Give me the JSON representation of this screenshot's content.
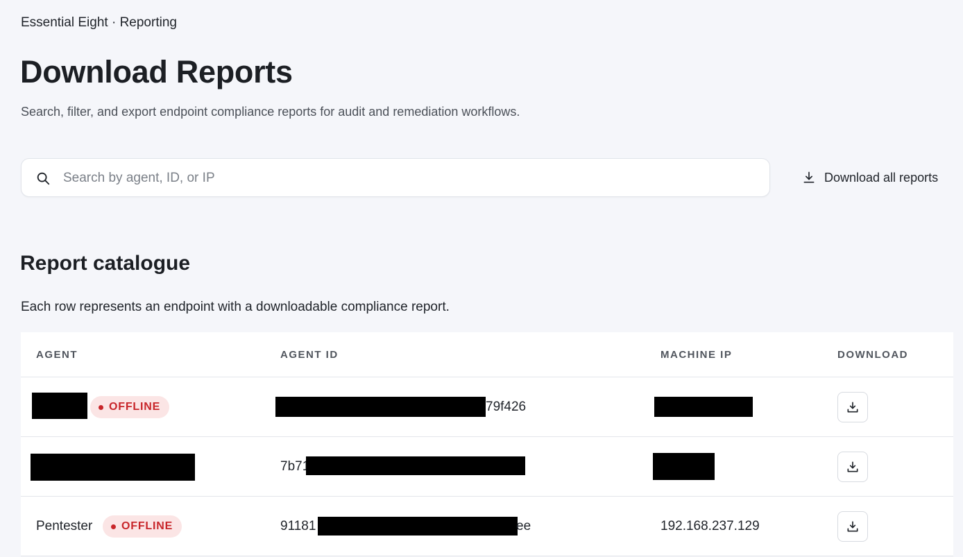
{
  "breadcrumb": "Essential Eight · Reporting",
  "title": "Download Reports",
  "subtitle": "Search, filter, and export endpoint compliance reports for audit and remediation workflows.",
  "search": {
    "placeholder": "Search by agent, ID, or IP",
    "value": "",
    "icon": "search-icon"
  },
  "download_all": {
    "label": "Download all reports",
    "icon": "download-icon"
  },
  "catalogue": {
    "title": "Report catalogue",
    "description": "Each row represents an endpoint with a downloadable compliance report."
  },
  "table": {
    "columns": [
      "AGENT",
      "AGENT ID",
      "MACHINE IP",
      "DOWNLOAD"
    ],
    "rows": [
      {
        "agent": "",
        "status": "OFFLINE",
        "agent_id": "79f426",
        "machine_ip": ""
      },
      {
        "agent": "",
        "status": "",
        "agent_id": "7b71",
        "machine_ip": ""
      },
      {
        "agent": "Pentester",
        "status": "OFFLINE",
        "agent_id_prefix": "91181",
        "agent_id_suffix": "ee",
        "machine_ip": "192.168.237.129"
      }
    ]
  },
  "colors": {
    "background": "#f5f6fa",
    "offline_badge_bg": "#fbe5e5",
    "offline_badge_text": "#c8262a"
  }
}
